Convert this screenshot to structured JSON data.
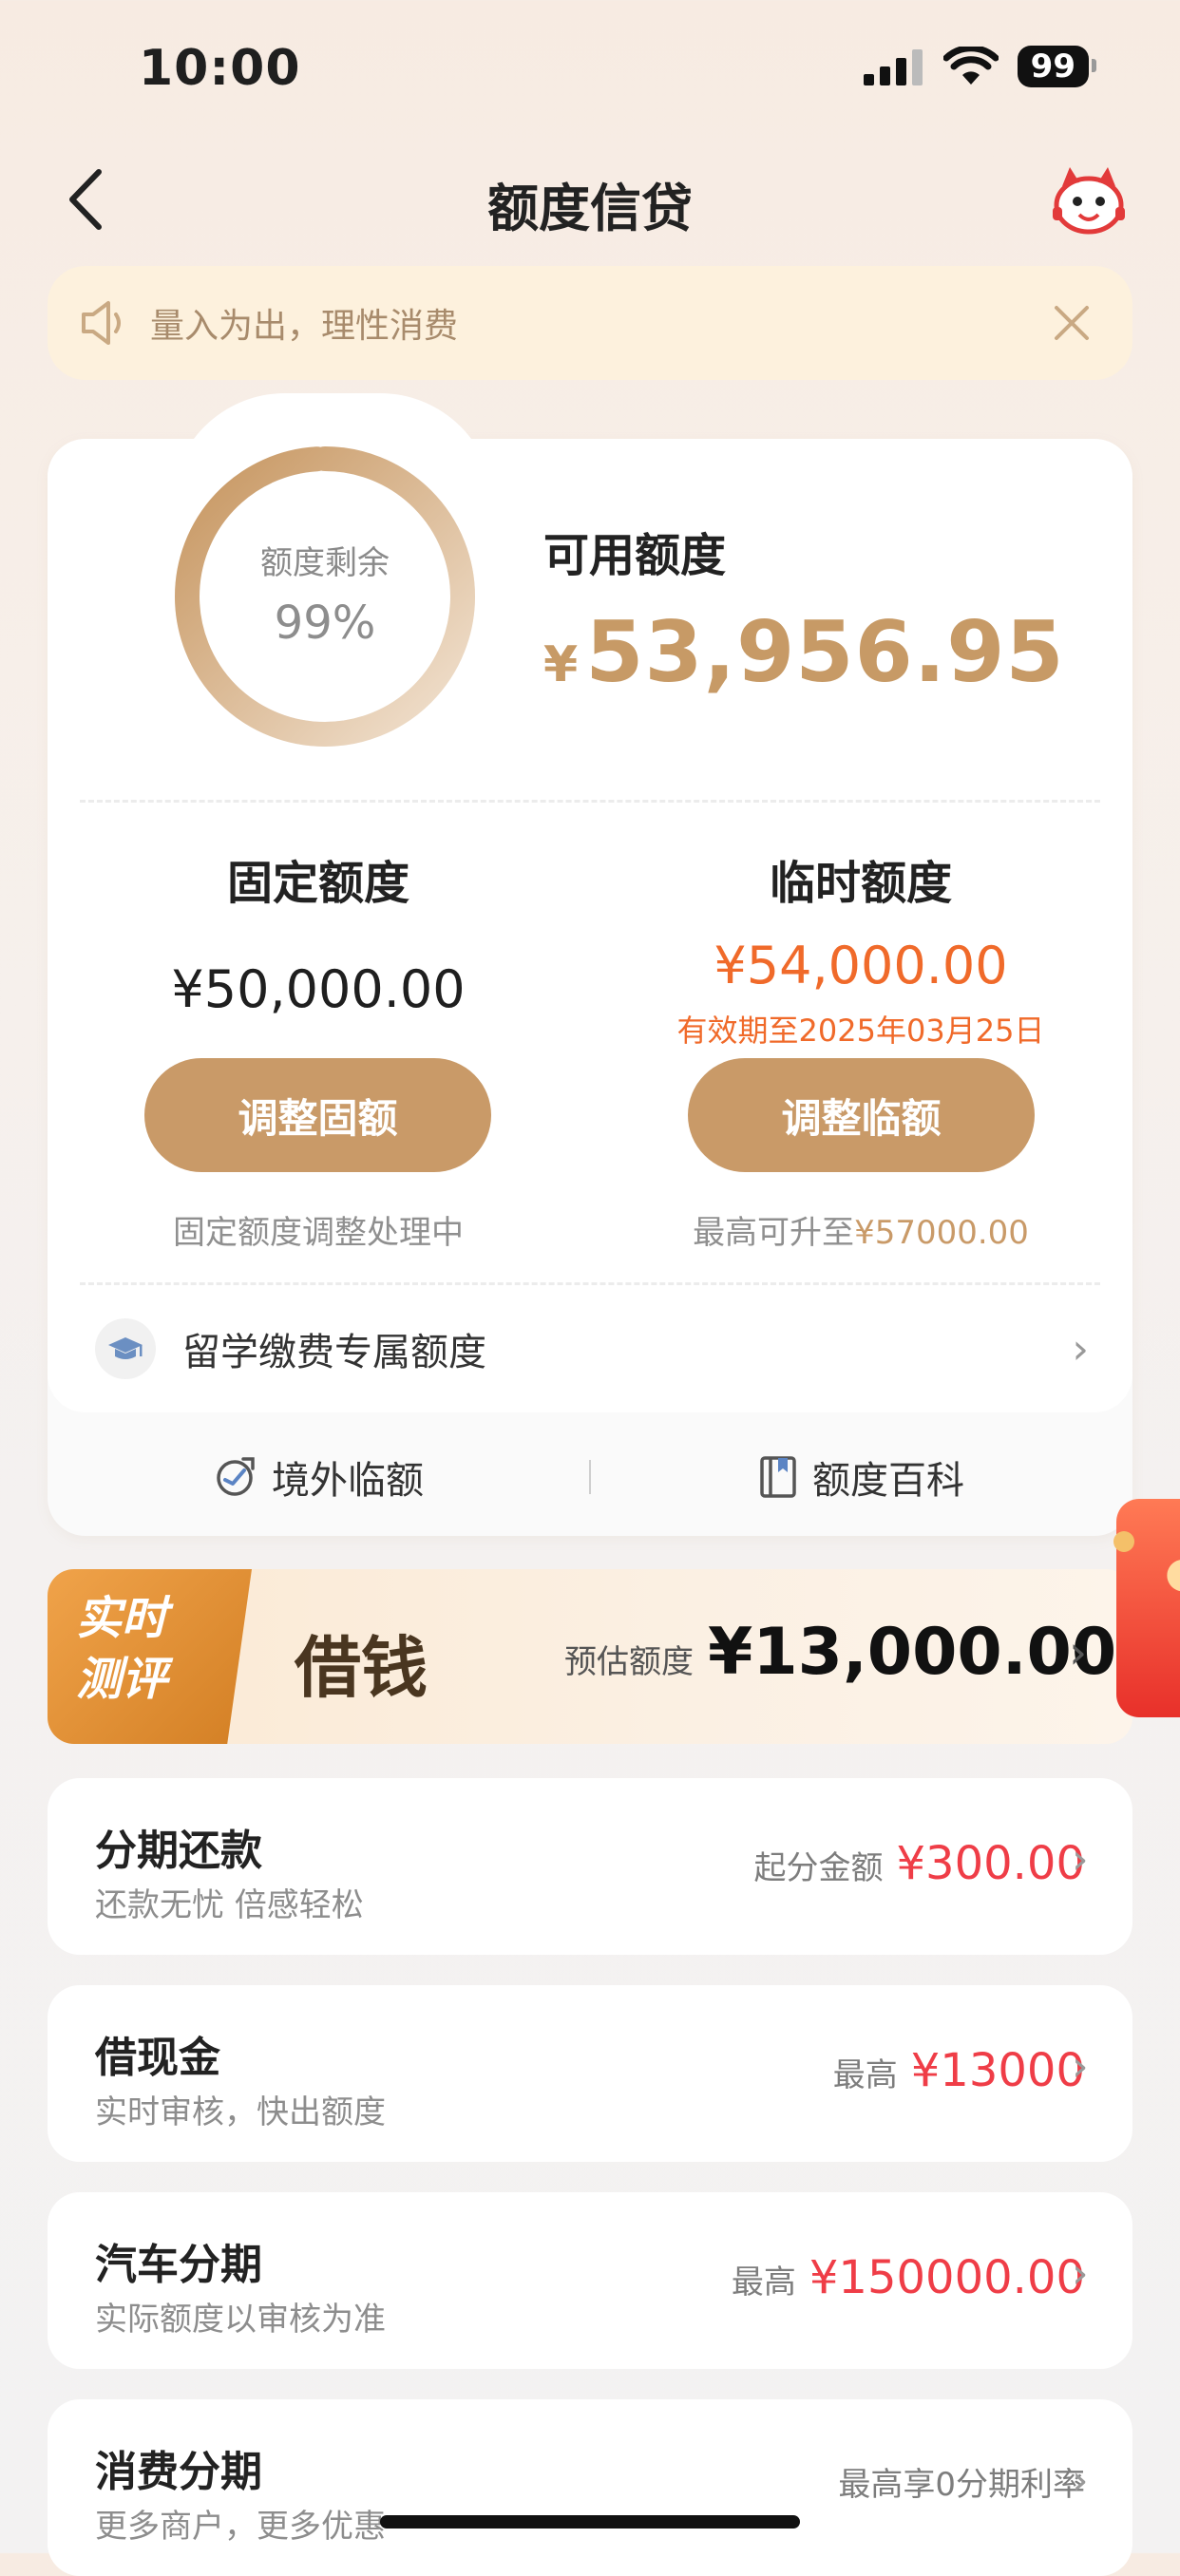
{
  "status_bar": {
    "time": "10:00",
    "battery": "99"
  },
  "header": {
    "title": "额度信贷"
  },
  "notice": {
    "text": "量入为出，理性消费"
  },
  "credit": {
    "ring_label": "额度剩余",
    "ring_value": "99%",
    "ring_fraction": 0.99,
    "available_label": "可用额度",
    "available_symbol": "¥",
    "available_amount": "53,956.95"
  },
  "fixed": {
    "title": "固定额度",
    "amount": "¥50,000.00",
    "button": "调整固额",
    "note": "固定额度调整处理中"
  },
  "temp": {
    "title": "临时额度",
    "amount": "¥54,000.00",
    "validity": "有效期至2025年03月25日",
    "button": "调整临额",
    "note_prefix": "最高可升至",
    "note_value": "¥57000.00"
  },
  "study": {
    "label": "留学缴费专属额度"
  },
  "sub_links": {
    "overseas": "境外临额",
    "wiki": "额度百科"
  },
  "loan": {
    "badge_line1": "实时",
    "badge_line2": "测评",
    "title": "借钱",
    "estimate_label": "预估额度",
    "estimate_value": "¥13,000.00"
  },
  "services": [
    {
      "title": "分期还款",
      "subtitle": "还款无忧 倍感轻松",
      "right_label": "起分金额",
      "right_value": "¥300.00"
    },
    {
      "title": "借现金",
      "subtitle": "实时审核，快出额度",
      "right_label": "最高",
      "right_value": "¥13000"
    },
    {
      "title": "汽车分期",
      "subtitle": "实际额度以审核为准",
      "right_label": "最高",
      "right_value": "¥150000.00"
    },
    {
      "title": "消费分期",
      "subtitle": "更多商户，更多优惠",
      "right_label": "最高享0分期利率",
      "right_value": ""
    }
  ],
  "colors": {
    "gold": "#c99a68",
    "orange": "#f06a2a",
    "red": "#ef3d47"
  }
}
